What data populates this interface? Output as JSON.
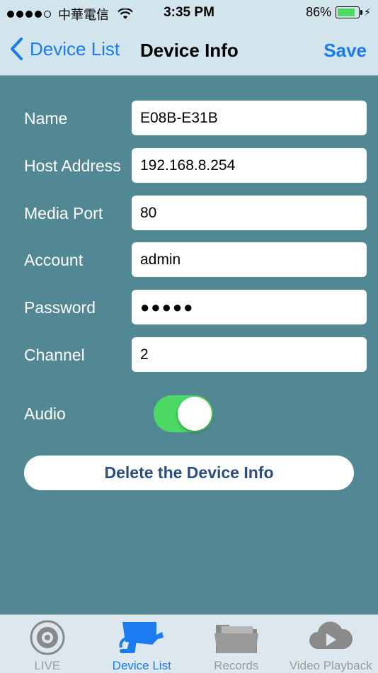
{
  "status_bar": {
    "carrier": "中華電信",
    "time": "3:35 PM",
    "battery_percent": "86%",
    "battery_level": 0.86
  },
  "nav": {
    "back_label": "Device List",
    "title": "Device Info",
    "save_label": "Save"
  },
  "form": {
    "name": {
      "label": "Name",
      "value": "E08B-E31B"
    },
    "host": {
      "label": "Host Address",
      "value": "192.168.8.254"
    },
    "media_port": {
      "label": "Media Port",
      "value": "80"
    },
    "account": {
      "label": "Account",
      "value": "admin"
    },
    "password": {
      "label": "Password",
      "value": "●●●●●"
    },
    "channel": {
      "label": "Channel",
      "value": "2"
    },
    "audio": {
      "label": "Audio",
      "enabled": true
    }
  },
  "delete_button": {
    "label": "Delete the Device Info"
  },
  "tabs": [
    {
      "label": "LIVE",
      "icon": "live-icon",
      "active": false
    },
    {
      "label": "Device List",
      "icon": "camera-icon",
      "active": true
    },
    {
      "label": "Records",
      "icon": "folder-icon",
      "active": false
    },
    {
      "label": "Video Playback",
      "icon": "cloud-play-icon",
      "active": false
    }
  ],
  "colors": {
    "accent": "#1a7cf0",
    "background": "#518893",
    "header": "#d2e4ec",
    "toggle_on": "#4cd964",
    "delete_text": "#2d4e7c"
  }
}
